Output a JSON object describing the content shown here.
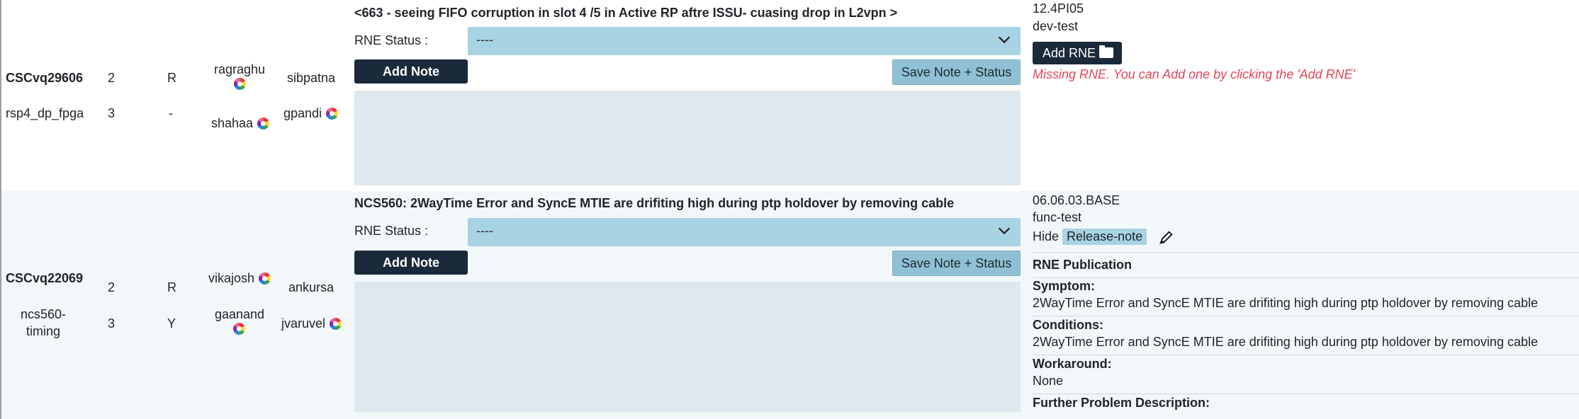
{
  "rows": [
    {
      "bug_id": "CSCvq29606",
      "component": "rsp4_dp_fpga",
      "sev": "2",
      "sev2": "3",
      "state": "R",
      "state2": "-",
      "eng1": "ragraghu",
      "eng2": "shahaa",
      "mgr1": "sibpatna",
      "mgr2": "gpandi",
      "headline": "<663 - seeing FIFO corruption in slot 4 /5 in Active RP aftre ISSU- cuasing drop in L2vpn >",
      "rne_status_label": "RNE Status :",
      "rne_status_value": "----",
      "add_note_label": "Add Note",
      "save_label": "Save Note + Status",
      "version": "12.4PI05",
      "branch": "dev-test",
      "add_rne_label": "Add RNE",
      "missing_msg": "Missing RNE. You can Add one by clicking the 'Add RNE'"
    },
    {
      "bug_id": "CSCvq22069",
      "component_l1": "ncs560-",
      "component_l2": "timing",
      "sev": "2",
      "sev2": "3",
      "state": "R",
      "state2": "Y",
      "eng1": "vikajosh",
      "eng2": "gaanand",
      "mgr1": "ankursa",
      "mgr2": "jvaruvel",
      "headline": "NCS560: 2WayTime Error and SyncE MTIE are drifiting high during ptp holdover by removing cable",
      "rne_status_label": "RNE Status :",
      "rne_status_value": "----",
      "add_note_label": "Add Note",
      "save_label": "Save Note + Status",
      "version": "06.06.03.BASE",
      "branch": "func-test",
      "hide_label": "Hide",
      "release_note_tag": "Release-note",
      "rne_publication": "RNE Publication",
      "symptom_label": "Symptom:",
      "symptom_text": "2WayTime Error and SyncE MTIE are drifiting high during ptp holdover by removing cable",
      "conditions_label": "Conditions:",
      "conditions_text": "2WayTime Error and SyncE MTIE are drifiting high during ptp holdover by removing cable",
      "workaround_label": "Workaround:",
      "workaround_text": "None",
      "further_label": "Further Problem Description:"
    }
  ],
  "colors": {
    "dark_button": "#1b2a3a",
    "select_bg": "#a8d3e3",
    "note_bg": "#dfe8ef",
    "missing_text": "#e0465a",
    "row2_bg": "#f2f7f9"
  },
  "icons": [
    "avatar-wheel-icon",
    "chevron-down-icon",
    "folder-plus-icon",
    "pencil-icon"
  ]
}
